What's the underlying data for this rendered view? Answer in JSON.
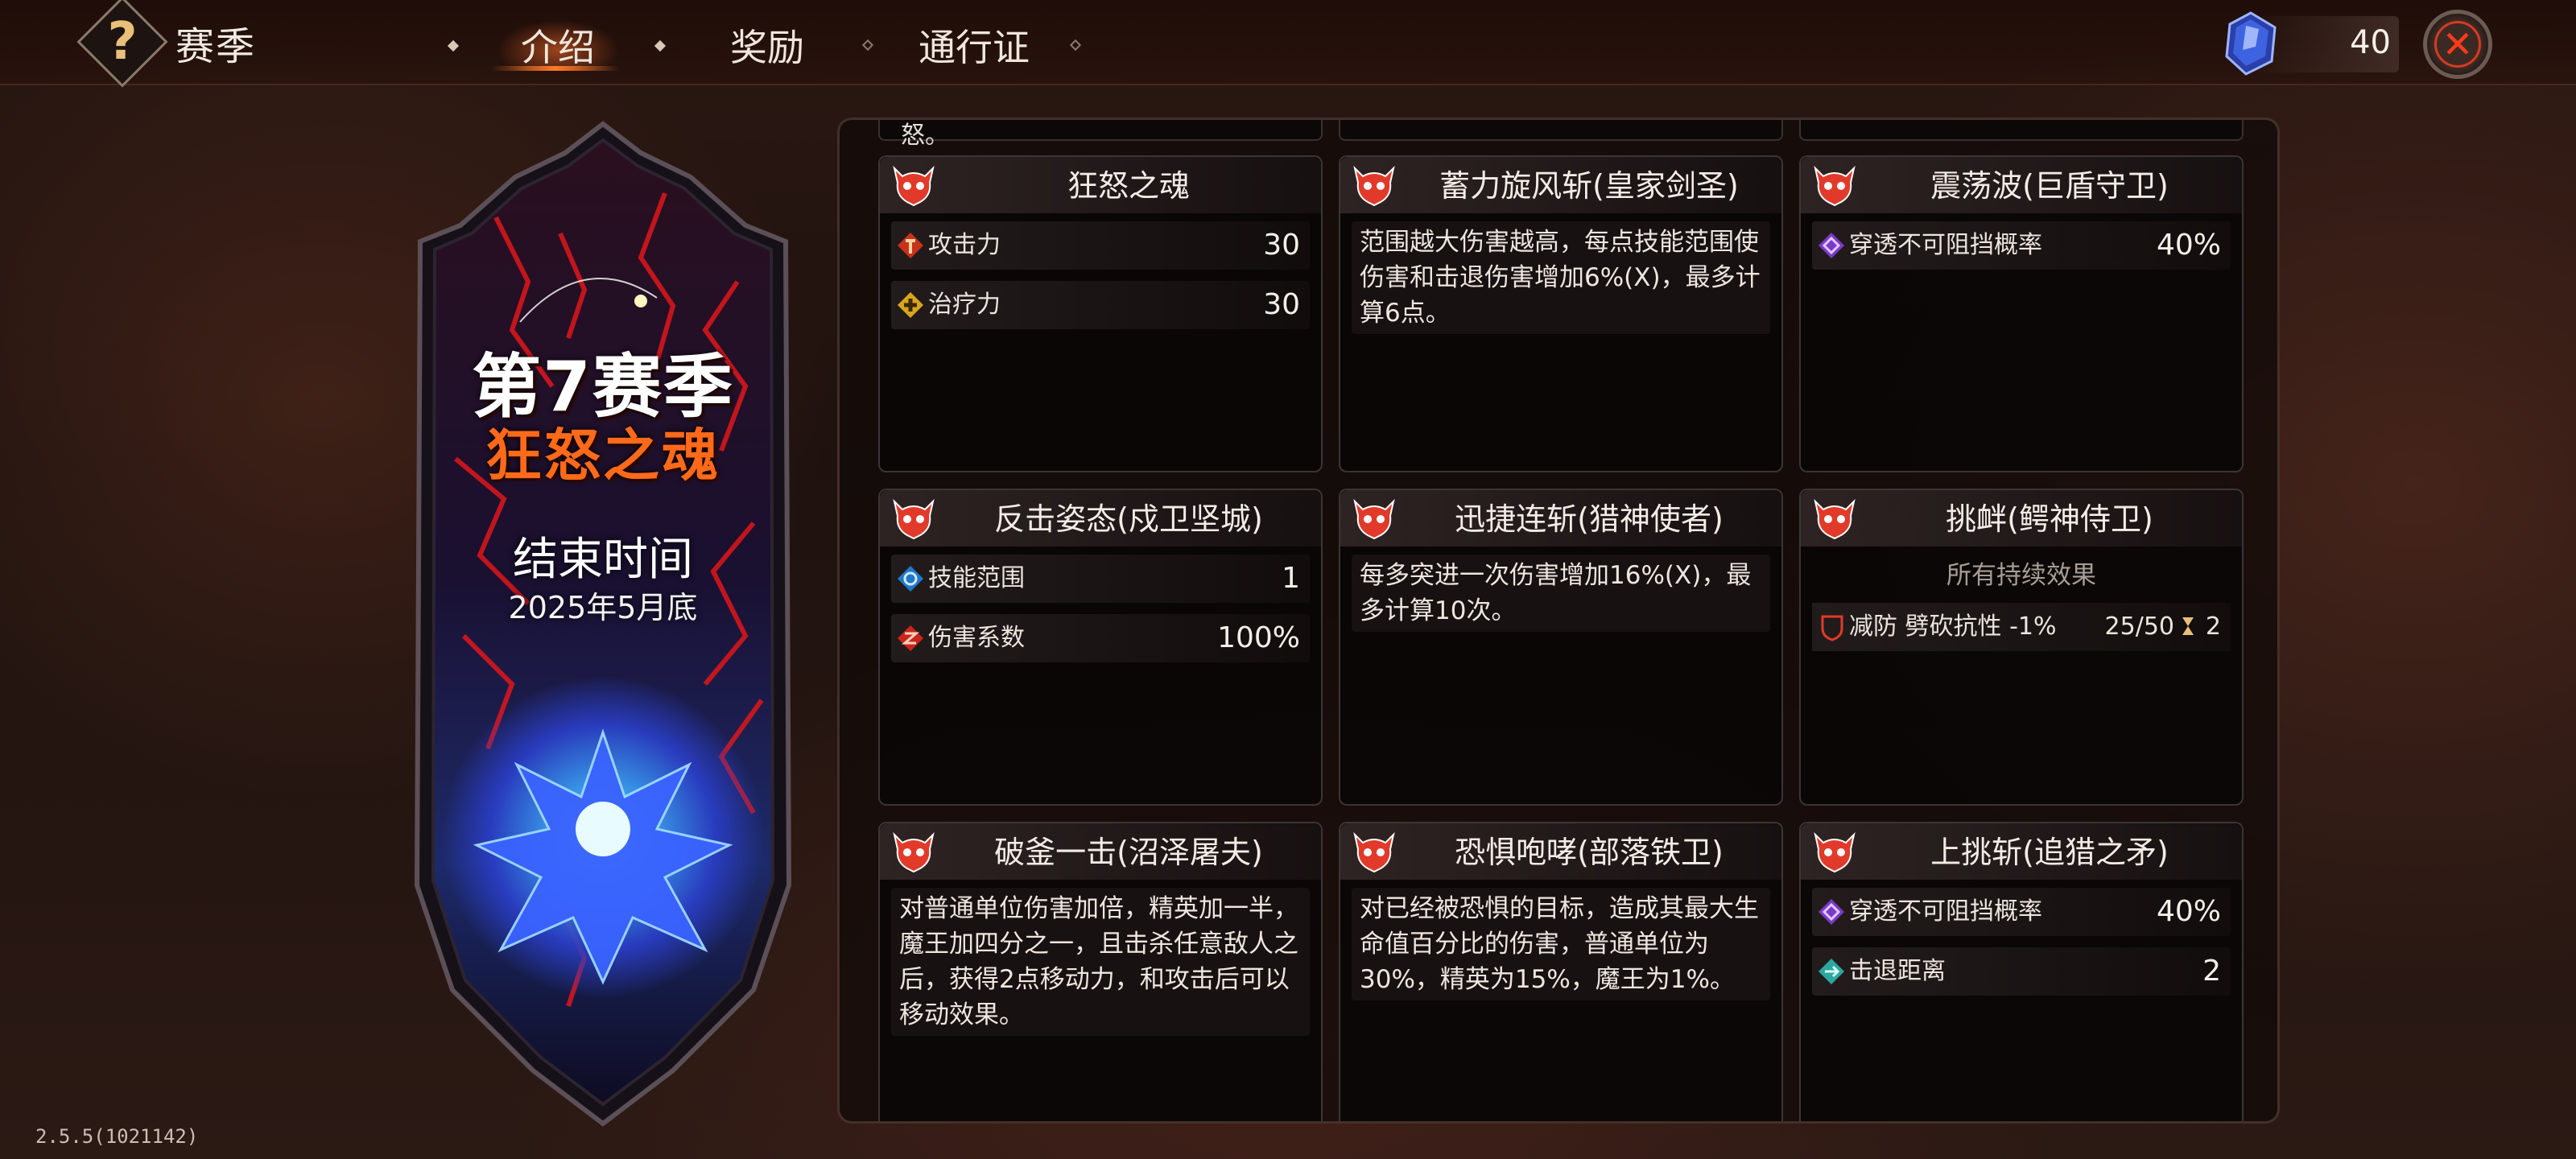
{
  "header": {
    "title": "赛季",
    "tabs": [
      {
        "label": "介绍",
        "active": true
      },
      {
        "label": "奖励",
        "active": false
      },
      {
        "label": "通行证",
        "active": false
      }
    ],
    "gem_count": "40",
    "accent_color": "#ff6a1a"
  },
  "banner": {
    "season_title": "第7赛季",
    "season_name": "狂怒之魂",
    "end_label": "结束时间",
    "end_date": "2025年5月底"
  },
  "version": "2.5.5(1021142)",
  "panel": {
    "partial_text": "怒。",
    "cards": [
      {
        "title": "狂怒之魂",
        "stats": [
          {
            "icon": "attack-icon",
            "label": "攻击力",
            "value": "30"
          },
          {
            "icon": "heal-icon",
            "label": "治疗力",
            "value": "30"
          }
        ]
      },
      {
        "title": "蓄力旋风斩(皇家剑圣)",
        "desc": "范围越大伤害越高，每点技能范围使伤害和击退伤害增加6%(X)，最多计算6点。"
      },
      {
        "title": "震荡波(巨盾守卫)",
        "stats": [
          {
            "icon": "pierce-icon",
            "label": "穿透不可阻挡概率",
            "value": "40%"
          }
        ]
      },
      {
        "title": "反击姿态(戍卫坚城)",
        "stats": [
          {
            "icon": "range-icon",
            "label": "技能范围",
            "value": "1"
          },
          {
            "icon": "damage-coefficient-icon",
            "label": "伤害系数",
            "value": "100%"
          }
        ]
      },
      {
        "title": "迅捷连斩(猎神使者)",
        "desc": "每多突进一次伤害增加16%(X)，最多计算10次。"
      },
      {
        "title": "挑衅(鳄神侍卫)",
        "note": "所有持续效果",
        "effect": {
          "text": "减防  劈砍抗性 -1%",
          "stack": "25/50",
          "turns": "2"
        }
      },
      {
        "title": "破釜一击(沼泽屠夫)",
        "desc": "对普通单位伤害加倍，精英加一半，魔王加四分之一，且击杀任意敌人之后，获得2点移动力，和攻击后可以移动效果。"
      },
      {
        "title": "恐惧咆哮(部落铁卫)",
        "desc": "对已经被恐惧的目标，造成其最大生命值百分比的伤害，普通单位为30%，精英为15%，魔王为1%。"
      },
      {
        "title": "上挑斩(追猎之矛)",
        "stats": [
          {
            "icon": "pierce-icon",
            "label": "穿透不可阻挡概率",
            "value": "40%"
          },
          {
            "icon": "knockback-icon",
            "label": "击退距离",
            "value": "2"
          }
        ]
      }
    ]
  }
}
